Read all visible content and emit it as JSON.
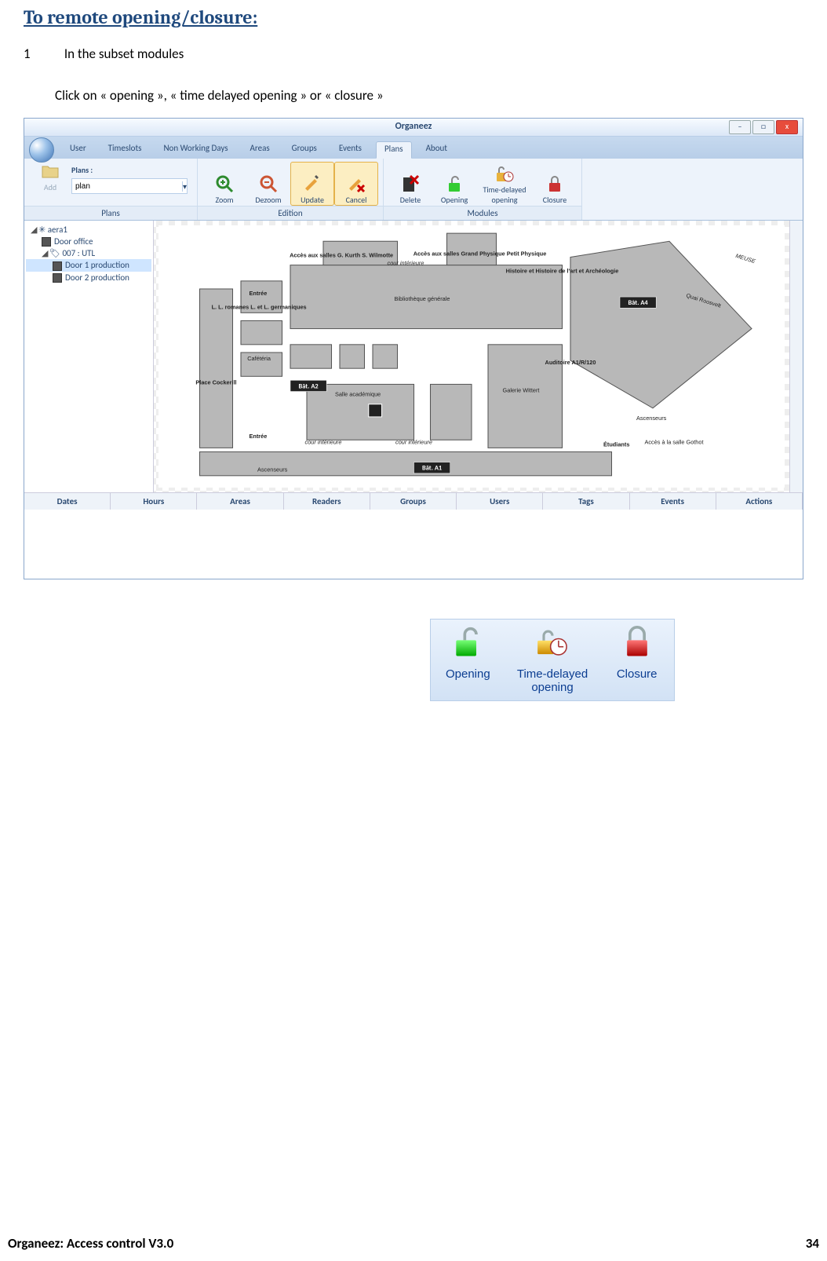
{
  "doc": {
    "heading": "To remote opening/closure:",
    "step_num": "1",
    "step_title": "In the subset modules",
    "instruction": "Click on « opening », « time delayed opening » or « closure »",
    "footer_left": "Organeez: Access control    V3.0",
    "footer_right": "34"
  },
  "app": {
    "title": "Organeez",
    "window_buttons": {
      "min": "–",
      "max": "□",
      "close": "x"
    },
    "tabs": [
      "User",
      "Timeslots",
      "Non Working Days",
      "Areas",
      "Groups",
      "Events",
      "Plans",
      "About"
    ],
    "active_tab": "Plans",
    "ribbon": {
      "add": "Add",
      "plans_label": "Plans :",
      "plans_value": "plan",
      "group_plans": "Plans",
      "zoom": "Zoom",
      "dezoom": "Dezoom",
      "update": "Update",
      "cancel": "Cancel",
      "group_edition": "Edition",
      "delete": "Delete",
      "opening": "Opening",
      "time_delayed": "Time-delayed opening",
      "closure": "Closure",
      "group_modules": "Modules"
    },
    "tree": {
      "n0": "aera1",
      "n1": "Door office",
      "n2": "007 : UTL",
      "n3": "Door 1 production",
      "n4": "Door 2 production"
    },
    "map_labels": {
      "acces1": "Accès aux salles G. Kurth S. Wilmotte",
      "cour1": "cour intérieure",
      "acces2": "Accès aux salles Grand Physique Petit Physique",
      "hist": "Histoire et Histoire de l'art et Archéologie",
      "bata4": "Bât. A4",
      "meuse": "MEUSE",
      "quai": "Quai Roosvelt",
      "entree1": "Entrée",
      "ll": "L. L. romanes L. et L. germaniques",
      "cafet": "Cafétéria",
      "biblio": "Bibliothèque générale",
      "place": "Place Cockerill",
      "bata2": "Bât. A2",
      "salle": "Salle académique",
      "galerie": "Galerie Wittert",
      "aud": "Auditoire A1/R/120",
      "asc": "Ascenseurs",
      "etud": "Étudiants",
      "gothot": "Accès à la salle Gothot",
      "entree2": "Entrée",
      "cour2": "cour intérieure",
      "cour3": "cour intérieure",
      "bata1": "Bât. A1",
      "asc2": "Ascenseurs"
    },
    "bottom_tabs": [
      "Dates",
      "Hours",
      "Areas",
      "Readers",
      "Groups",
      "Users",
      "Tags",
      "Events",
      "Actions"
    ]
  },
  "detail": {
    "opening": "Opening",
    "time_delayed": "Time-delayed opening",
    "closure": "Closure"
  }
}
